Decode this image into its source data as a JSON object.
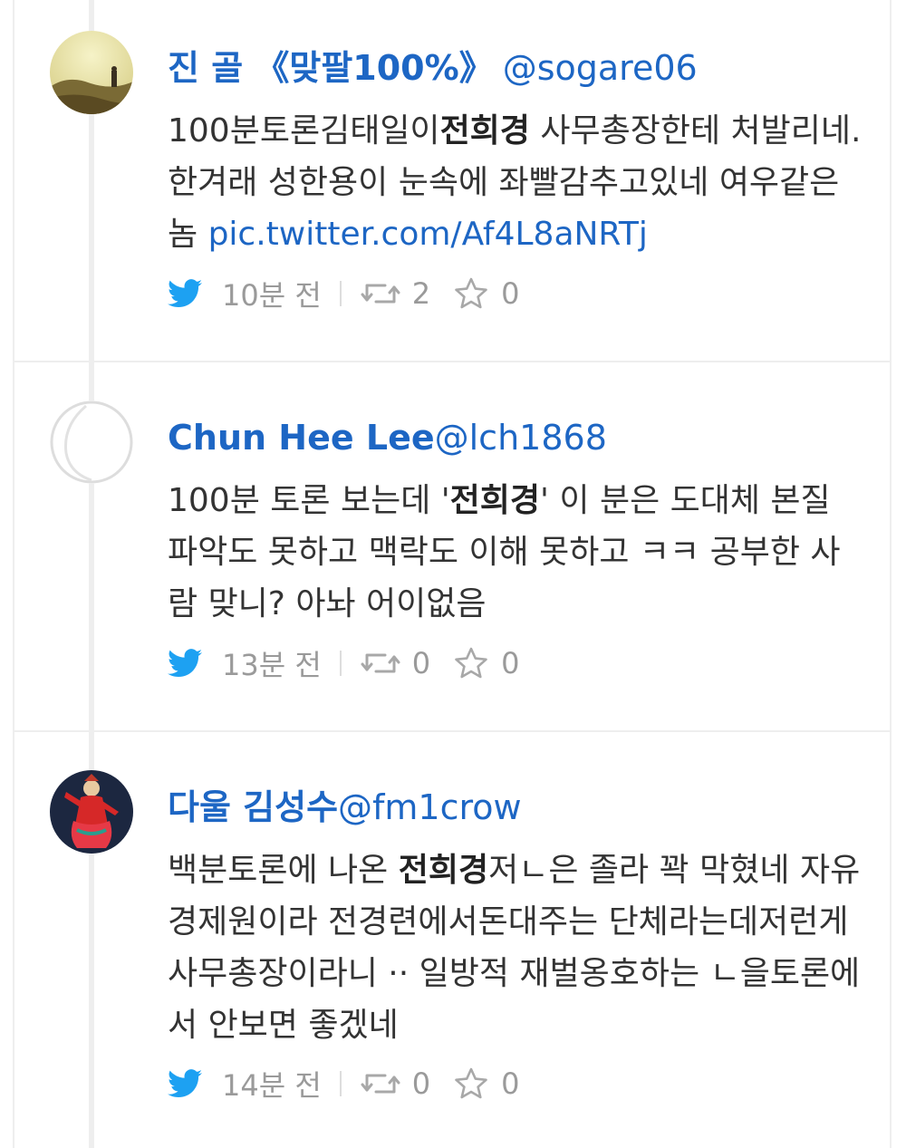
{
  "tweets": [
    {
      "name": "진 골 《맞팔100%》",
      "handle": "@sogare06",
      "text_parts": [
        "100분토론김태일이",
        "전희경",
        " 사무총장한테 처발리네.한겨래 성한용이 눈속에 좌빨감추고있네 여우같은놈 "
      ],
      "link": "pic.twitter.com/Af4L8aNRTj",
      "time": "10분 전",
      "retweets": "2",
      "favorites": "0",
      "avatar": "landscape-avatar"
    },
    {
      "name": "Chun Hee Lee",
      "handle": "@lch1868",
      "text_parts": [
        "100분 토론 보는데 '",
        "전희경",
        "' 이 분은 도대체 본질 파악도 못하고 맥락도 이해 못하고 ㅋㅋ 공부한 사람 맞니? 아놔 어이없음"
      ],
      "link": "",
      "time": "13분 전",
      "retweets": "0",
      "favorites": "0",
      "avatar": "default-egg-avatar"
    },
    {
      "name": "다울 김성수",
      "handle": "@fm1crow",
      "text_parts": [
        "백분토론에 나온 ",
        "전희경",
        "저ㄴ은 졸라 꽉 막혔네 자유경제원이라 전경련에서돈대주는 단체라는데저런게 사무총장이라니 ·· 일방적 재벌옹호하는 ㄴ을토론에서 안보면 좋겠네"
      ],
      "link": "",
      "time": "14분 전",
      "retweets": "0",
      "favorites": "0",
      "avatar": "illustration-avatar"
    }
  ],
  "colors": {
    "accent": "#1d66c4",
    "text": "#333333",
    "meta": "#9a9a9a",
    "bird": "#1da1f2",
    "divider": "#eeeeee"
  },
  "icons": {
    "bird": "twitter-bird-icon",
    "retweet": "retweet-icon",
    "favorite": "star-icon"
  }
}
